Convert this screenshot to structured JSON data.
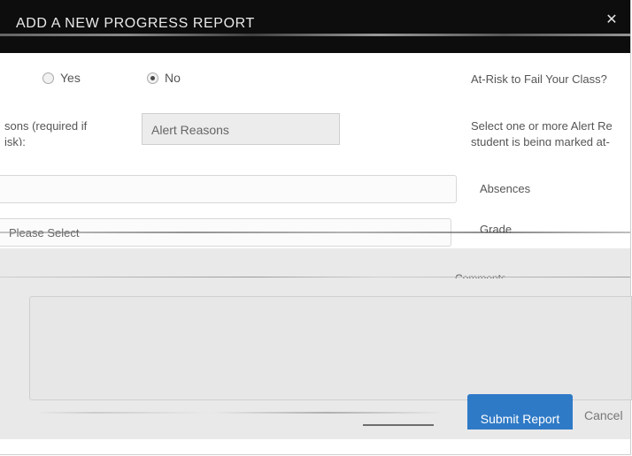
{
  "dialog": {
    "title": "ADD A NEW PROGRESS REPORT"
  },
  "at_risk": {
    "options": [
      {
        "label": "Yes",
        "checked": false
      },
      {
        "label": "No",
        "checked": true
      }
    ],
    "help": "At-Risk to Fail Your Class?"
  },
  "alert_reasons": {
    "label_line1": "sons (required if",
    "label_line2": "isk):",
    "placeholder": "Alert Reasons",
    "help_line1": "Select one or more Alert Re",
    "help_line2": "student is being marked at-"
  },
  "absences": {
    "label": "Absences",
    "value": ""
  },
  "grade": {
    "selected": "Please Select",
    "label": "Grade"
  },
  "comments": {
    "label": "Comments"
  },
  "footer": {
    "submit_label": "Submit Report",
    "cancel_label": "Cancel"
  }
}
